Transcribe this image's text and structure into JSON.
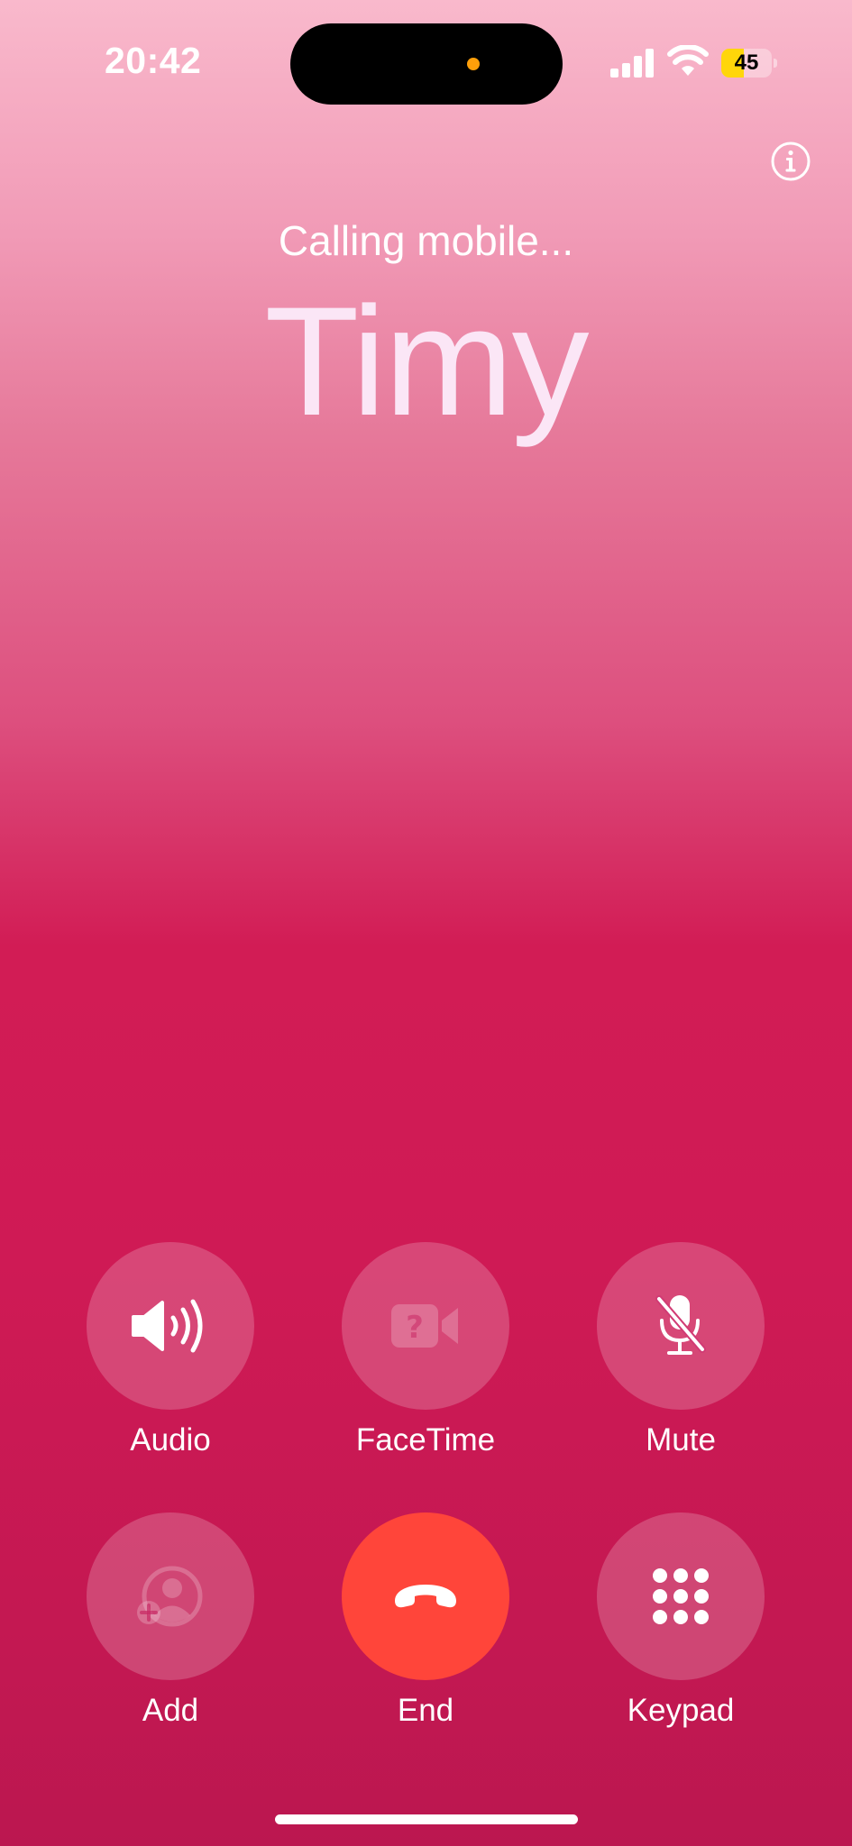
{
  "status_bar": {
    "time": "20:42",
    "battery_level": "45",
    "battery_fraction": 0.45,
    "indicator_dot_color": "#ff9f0a",
    "battery_color": "#ffd60a"
  },
  "header": {
    "info_icon": "info-circle-icon",
    "call_status": "Calling mobile...",
    "caller_name": "Timy"
  },
  "controls": {
    "audio": {
      "label": "Audio",
      "icon": "speaker-wave-icon",
      "enabled": true
    },
    "facetime": {
      "label": "FaceTime",
      "icon": "facetime-unavailable-icon",
      "enabled": false
    },
    "mute": {
      "label": "Mute",
      "icon": "microphone-slash-icon",
      "enabled": true
    },
    "add": {
      "label": "Add",
      "icon": "add-person-icon",
      "enabled": false
    },
    "end": {
      "label": "End",
      "icon": "phone-hangup-icon",
      "color": "#ff453a"
    },
    "keypad": {
      "label": "Keypad",
      "icon": "keypad-grid-icon",
      "enabled": true
    }
  }
}
